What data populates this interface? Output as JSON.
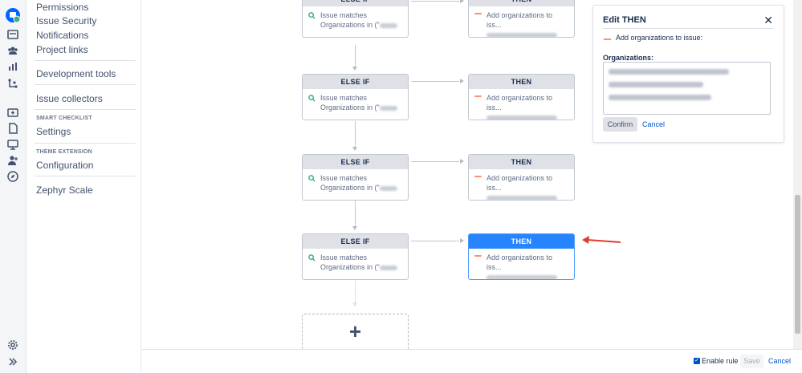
{
  "sidebar": {
    "items": [
      {
        "label": "Permissions"
      },
      {
        "label": "Issue Security"
      },
      {
        "label": "Notifications"
      },
      {
        "label": "Project links"
      },
      {
        "label": "Development tools"
      },
      {
        "label": "Issue collectors"
      },
      {
        "label": "Settings"
      },
      {
        "label": "Configuration"
      },
      {
        "label": "Zephyr Scale"
      }
    ],
    "sections": {
      "smart_checklist": "SMART CHECKLIST",
      "theme_extension": "THEME EXTENSION"
    }
  },
  "rail": {
    "icons": [
      "project-avatar-icon",
      "board-icon",
      "people-icon",
      "reports-icon",
      "components-icon",
      "add-issue-icon",
      "page-icon",
      "desktop-icon",
      "add-user-icon",
      "compass-icon",
      "settings-icon",
      "expand-icon"
    ]
  },
  "flow": {
    "rows": [
      {
        "left_header": "ELSE IF",
        "left_line1": "Issue matches",
        "left_line2": "Organizations in (\"",
        "right_header": "THEN",
        "right_line1": "Add organizations to iss..."
      },
      {
        "left_header": "ELSE IF",
        "left_line1": "Issue matches",
        "left_line2": "Organizations in (\"",
        "right_header": "THEN",
        "right_line1": "Add organizations to iss..."
      },
      {
        "left_header": "ELSE IF",
        "left_line1": "Issue matches",
        "left_line2": "Organizations in (\"",
        "right_header": "THEN",
        "right_line1": "Add organizations to iss..."
      },
      {
        "left_header": "ELSE IF",
        "left_line1": "Issue matches",
        "left_line2": "Organizations in (\"",
        "right_header": "THEN",
        "right_line1": "Add organizations to iss...",
        "active": true
      }
    ],
    "add_label": "+"
  },
  "panel": {
    "title": "Edit THEN",
    "close": "✕",
    "action": "Add organizations to issue:",
    "field_label": "Organizations:",
    "confirm": "Confirm",
    "cancel": "Cancel"
  },
  "footer": {
    "enable_rule": "Enable rule",
    "enable_checked": true,
    "save": "Save",
    "cancel": "Cancel"
  },
  "colors": {
    "active_header": "#2684ff",
    "link": "#0052cc",
    "annotation_arrow": "#e03c31"
  }
}
